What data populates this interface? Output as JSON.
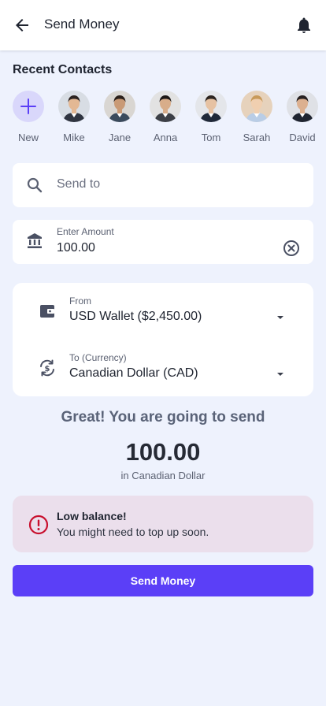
{
  "header": {
    "title": "Send Money",
    "back_icon": "arrow-left-icon",
    "bell_icon": "bell-icon"
  },
  "contacts": {
    "section_title": "Recent Contacts",
    "new_label": "New",
    "items": [
      {
        "name": "Mike",
        "skin": "#e3b894",
        "hair": "#2b2220",
        "shirt": "#2f3440",
        "bg": "#d8dde4"
      },
      {
        "name": "Jane",
        "skin": "#c99a76",
        "hair": "#2a1f1a",
        "shirt": "#3a4a5c",
        "bg": "#d9d6d2"
      },
      {
        "name": "Anna",
        "skin": "#d8ad8a",
        "hair": "#1c1716",
        "shirt": "#3c3f46",
        "bg": "#e2e2e2"
      },
      {
        "name": "Tom",
        "skin": "#e6c2a3",
        "hair": "#2c241f",
        "shirt": "#1f2838",
        "bg": "#e4e6ea"
      },
      {
        "name": "Sarah",
        "skin": "#f0cfb0",
        "hair": "#c89a5a",
        "shirt": "#b9cde6",
        "bg": "#e6d2bc"
      },
      {
        "name": "David",
        "skin": "#dcb090",
        "hair": "#262020",
        "shirt": "#1f2430",
        "bg": "#dfe1e6"
      }
    ]
  },
  "send_to": {
    "placeholder": "Send to",
    "icon": "search-icon"
  },
  "amount": {
    "label": "Enter Amount",
    "value": "100.00",
    "icon": "bank-icon",
    "clear_icon": "clear-circle-icon"
  },
  "from": {
    "label": "From",
    "value": "USD Wallet ($2,450.00)",
    "icon": "wallet-icon"
  },
  "to": {
    "label": "To (Currency)",
    "value": "Canadian Dollar (CAD)",
    "icon": "currency-exchange-icon"
  },
  "summary": {
    "heading": "Great! You are going to send",
    "amount": "100.00",
    "sub": "in Canadian Dollar"
  },
  "alert": {
    "title": "Low balance!",
    "text": "You might need to top up soon.",
    "icon": "error-icon",
    "color": "#c8102e"
  },
  "action": {
    "label": "Send Money",
    "color": "#5b3ff7"
  }
}
